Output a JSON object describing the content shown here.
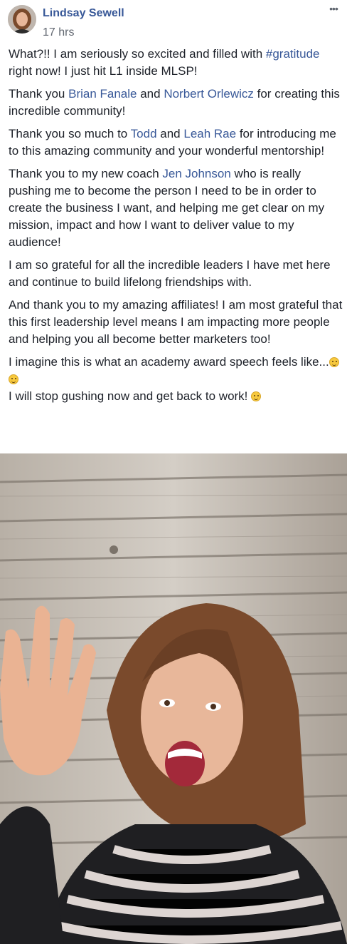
{
  "post": {
    "author": "Lindsay Sewell",
    "timestamp": "17 hrs",
    "more_label": "•••",
    "paragraphs": [
      {
        "segments": [
          {
            "text": "What?!! I am seriously so excited and filled with "
          },
          {
            "text": "#gratitude",
            "link": true
          },
          {
            "text": " right now! I just hit L1 inside MLSP!"
          }
        ]
      },
      {
        "segments": [
          {
            "text": "Thank you "
          },
          {
            "text": "Brian Fanale",
            "link": true
          },
          {
            "text": " and "
          },
          {
            "text": "Norbert Orlewicz",
            "link": true
          },
          {
            "text": " for creating this incredible community!"
          }
        ]
      },
      {
        "segments": [
          {
            "text": "Thank you so much to "
          },
          {
            "text": "Todd",
            "link": true
          },
          {
            "text": " and "
          },
          {
            "text": "Leah Rae",
            "link": true
          },
          {
            "text": " for introducing me to this amazing community and your wonderful mentorship!"
          }
        ]
      },
      {
        "segments": [
          {
            "text": "Thank you to my new coach "
          },
          {
            "text": "Jen Johnson",
            "link": true
          },
          {
            "text": " who is really pushing me to become the person I need to be in order to create the business I want, and helping me get clear on my mission, impact and how I want to deliver value to my audience!"
          }
        ]
      },
      {
        "segments": [
          {
            "text": "I am so grateful for all the incredible leaders I have met here and continue to build lifelong friendships with."
          }
        ]
      },
      {
        "segments": [
          {
            "text": "And thank you to my amazing affiliates! I am most grateful that this first leadership level means I am impacting more people and helping you all become better marketers too!"
          }
        ]
      },
      {
        "segments": [
          {
            "text": "I imagine this is what an academy award speech feels like..."
          },
          {
            "emoji": "laughing-face"
          },
          {
            "emoji": "rolling-laughing-face"
          },
          {
            "break": true
          },
          {
            "text": "I will stop gushing now and get back to work! "
          },
          {
            "emoji": "smiling-face"
          }
        ]
      }
    ]
  },
  "photo": {
    "icon": "woman-waving-photo",
    "colors": {
      "wood_light": "#c9c3bb",
      "wood_dark": "#8d857c",
      "hair": "#7a4a2c",
      "skin": "#e8b79a"
    }
  }
}
